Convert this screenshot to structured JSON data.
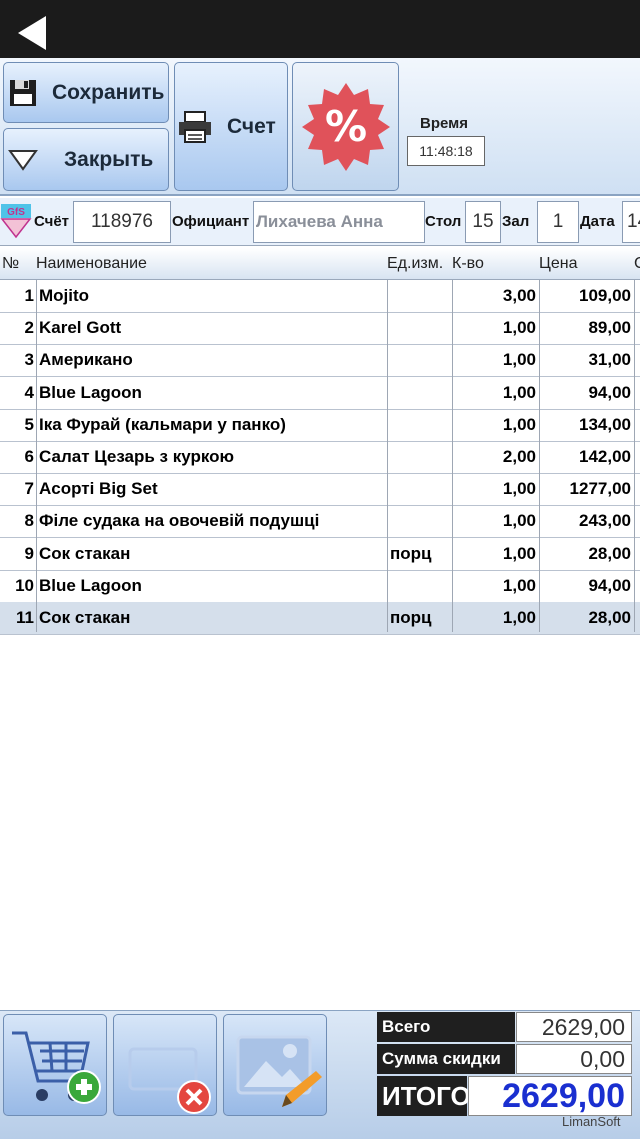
{
  "toolbar": {
    "save_label": "Сохранить",
    "close_label": "Закрыть",
    "check_label": "Счет",
    "time_label": "Время",
    "time_value": "11:48:18"
  },
  "info": {
    "check_label": "Счёт",
    "check_number": "118976",
    "waiter_label": "Официант",
    "waiter_name": "Лихачева Анна",
    "table_label": "Стол",
    "table_number": "15",
    "hall_label": "Зал",
    "hall_number": "1",
    "date_label": "Дата",
    "date_value": "14"
  },
  "table": {
    "headers": {
      "num": "№",
      "name": "Наименование",
      "unit": "Ед.изм.",
      "qty": "К-во",
      "price": "Цена",
      "extra": "С"
    },
    "rows": [
      {
        "num": "1",
        "name": "Mojito",
        "unit": "",
        "qty": "3,00",
        "price": "109,00"
      },
      {
        "num": "2",
        "name": "Karel Gott",
        "unit": "",
        "qty": "1,00",
        "price": "89,00"
      },
      {
        "num": "3",
        "name": "Американо",
        "unit": "",
        "qty": "1,00",
        "price": "31,00"
      },
      {
        "num": "4",
        "name": "Blue Lagoon",
        "unit": "",
        "qty": "1,00",
        "price": "94,00"
      },
      {
        "num": "5",
        "name": "Іка Фурай (кальмари у панко)",
        "unit": "",
        "qty": "1,00",
        "price": "134,00"
      },
      {
        "num": "6",
        "name": "Салат Цезарь з куркою",
        "unit": "",
        "qty": "2,00",
        "price": "142,00"
      },
      {
        "num": "7",
        "name": "Acoртi  Big Set",
        "unit": "",
        "qty": "1,00",
        "price": "1277,00"
      },
      {
        "num": "8",
        "name": "Філе судака на овочевій подушці",
        "unit": "",
        "qty": "1,00",
        "price": "243,00"
      },
      {
        "num": "9",
        "name": "Сок стакан",
        "unit": "порц",
        "qty": "1,00",
        "price": "28,00"
      },
      {
        "num": "10",
        "name": "Blue Lagoon",
        "unit": "",
        "qty": "1,00",
        "price": "94,00"
      },
      {
        "num": "11",
        "name": "Сок стакан",
        "unit": "порц",
        "qty": "1,00",
        "price": "28,00"
      }
    ]
  },
  "totals": {
    "total_label": "Всего",
    "total_value": "2629,00",
    "discount_label": "Сумма скидки",
    "discount_value": "0,00",
    "grand_label": "ИТОГО",
    "grand_value": "2629,00"
  },
  "brand": "LimanSoft",
  "colors": {
    "accent": "#1a2fd0",
    "discount_badge": "#e0525a"
  }
}
